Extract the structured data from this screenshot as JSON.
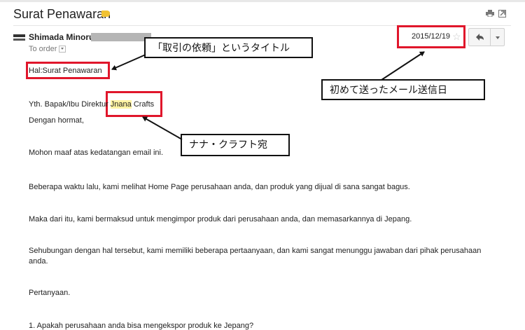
{
  "email": {
    "subject": "Surat Penawaran",
    "sender_name": "Shimada Minoru",
    "to_line": "To order",
    "date": "2015/12/19"
  },
  "body": {
    "hal": "Hal:Surat Penawaran",
    "yth_prefix": "Yth. Bapak/Ibu Direktur ",
    "yth_company_highlight": "Jnana",
    "yth_company_rest": " Crafts",
    "greeting": "Dengan hormat,",
    "p1": "Mohon maaf atas kedatangan email ini.",
    "p2": "Beberapa waktu lalu, kami melihat Home Page perusahaan anda, dan produk yang dijual di sana sangat bagus.",
    "p3": "Maka dari itu, kami bermaksud untuk mengimpor produk dari perusahaan anda, dan memasarkannya di Jepang.",
    "p4_line1": "Sehubungan dengan hal tersebut, kami memiliki beberapa pertaanyaan, dan kami sangat menunggu jawaban dari pihak perusahaan",
    "p4_line2": "anda.",
    "questions_heading": "Pertanyaan.",
    "q1": "1. Apakah perusahaan anda bisa mengekspor produk ke Jepang?"
  },
  "annotations": {
    "title_note": "「取引の依頼」というタイトル",
    "date_note": "初めて送ったメール送信日",
    "addressee_note": "ナナ・クラフト宛"
  },
  "colors": {
    "annotation_red": "#e0162b",
    "label_tag": "#f1c232",
    "name_highlight": "#fff3a3"
  },
  "icons": {
    "label": "label-tag-icon",
    "print": "print-icon",
    "popout": "popout-icon",
    "star": "star-icon",
    "reply": "reply-arrow-icon",
    "more": "chevron-down-icon"
  }
}
